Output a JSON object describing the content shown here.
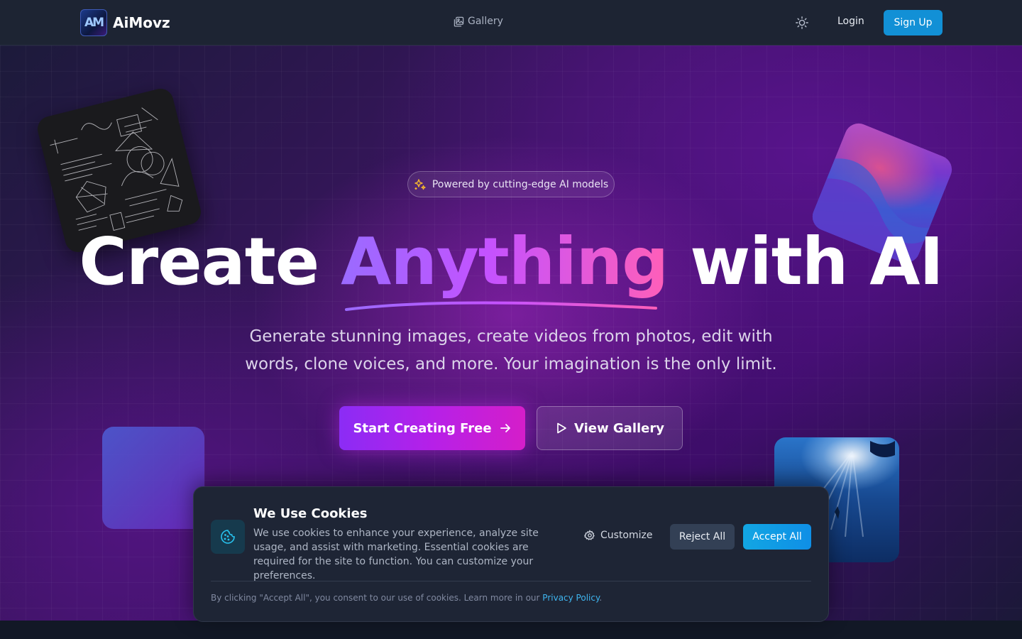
{
  "header": {
    "logo_mark": "AM",
    "brand": "AiMovz",
    "nav_gallery": "Gallery",
    "login": "Login",
    "signup": "Sign Up"
  },
  "hero": {
    "badge": "Powered by cutting-edge AI models",
    "headline_part1": "Create",
    "headline_highlight": "Anything",
    "headline_part2": "with AI",
    "subtitle": "Generate stunning images, create videos from photos, edit with words, clone voices, and more. Your imagination is the only limit.",
    "primary_cta": "Start Creating Free",
    "secondary_cta": "View Gallery"
  },
  "cookies": {
    "title": "We Use Cookies",
    "body": "We use cookies to enhance your experience, analyze site usage, and assist with marketing. Essential cookies are required for the site to function. You can customize your preferences.",
    "customize": "Customize",
    "reject": "Reject All",
    "accept": "Accept All",
    "footnote": "By clicking \"Accept All\", you consent to our use of cookies. Learn more in our",
    "privacy_link": "Privacy Policy",
    "footnote_end": "."
  },
  "colors": {
    "primary_gradient_start": "#8b2cf5",
    "primary_gradient_end": "#d51ec9",
    "signup_blue": "#1290d6",
    "accept_blue": "#12a6e3",
    "nav_bg": "#1d2433"
  },
  "icons": {
    "gallery": "images-icon",
    "theme": "sun-icon",
    "badge": "sparkles-icon",
    "primary_cta": "arrow-right-icon",
    "secondary_cta": "play-icon",
    "cookie": "cookie-icon",
    "customize": "gear-icon"
  }
}
